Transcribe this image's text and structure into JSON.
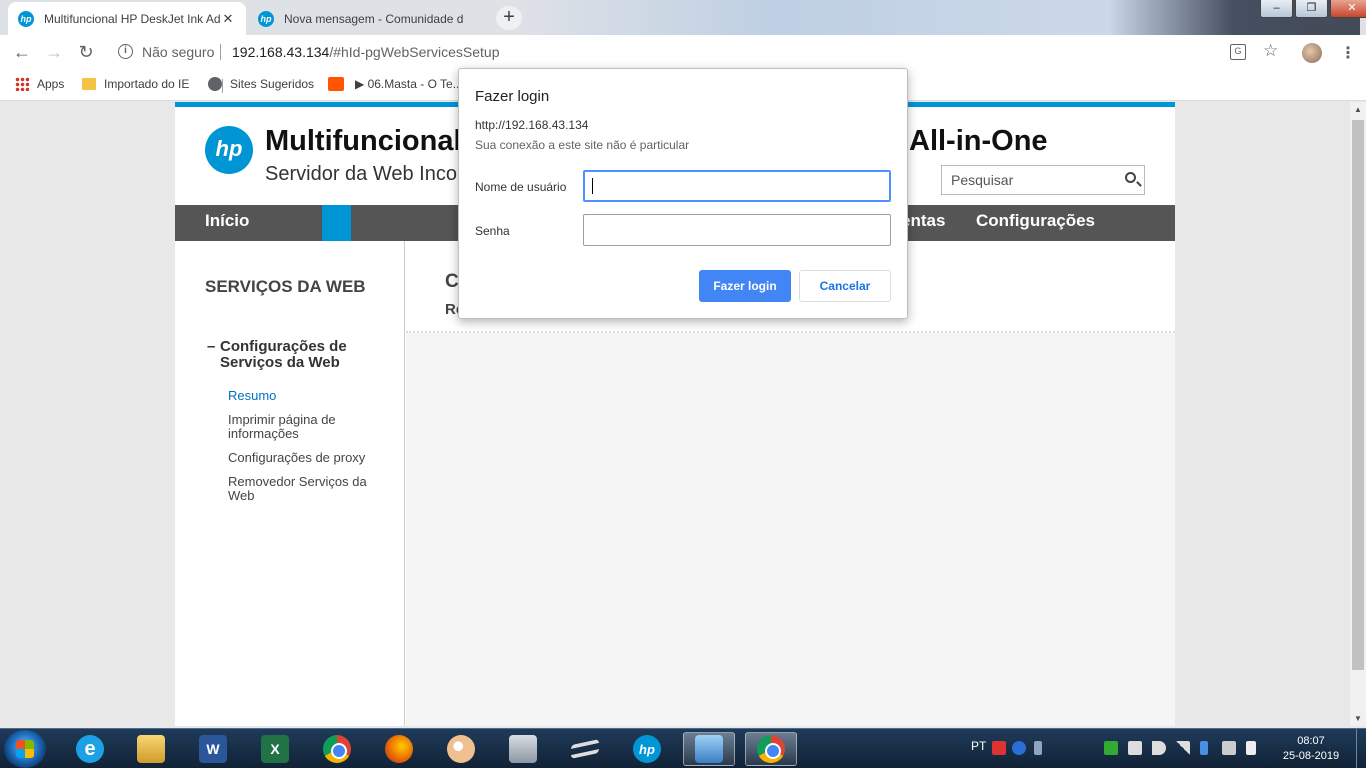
{
  "browser": {
    "tabs": [
      {
        "title": "Multifuncional HP DeskJet Ink Ad",
        "favicon": "hp",
        "active": true
      },
      {
        "title": "Nova mensagem - Comunidade d",
        "favicon": "hp",
        "active": false
      }
    ],
    "security_label": "Não seguro",
    "url_host": "192.168.43.134",
    "url_path": "/#hId-pgWebServicesSetup",
    "bookmarks": [
      {
        "label": "Apps",
        "icon": "apps-grid-icon"
      },
      {
        "label": "Importado do IE",
        "icon": "folder-icon"
      },
      {
        "label": "Sites Sugeridos",
        "icon": "globe-icon"
      },
      {
        "label": "",
        "icon": "soundcloud-icon"
      },
      {
        "label": "▶ 06.Masta - O Te...",
        "icon": ""
      }
    ]
  },
  "hp": {
    "title_start": "Multifuncional",
    "title_end": "All-in-One",
    "subtitle": "Servidor da Web Incorporado",
    "search_placeholder": "Pesquisar",
    "nav": {
      "home": "Início",
      "tools_partial": "entas",
      "settings": "Configurações"
    },
    "sidebar": {
      "title": "SERVIÇOS DA WEB",
      "group_marker": "–",
      "group": "Configurações de Serviços da Web",
      "links": [
        "Resumo",
        "Imprimir página de informações",
        "Configurações de proxy",
        "Removedor Serviços da Web"
      ]
    },
    "main": {
      "heading_partial": "Co",
      "subheading_partial": "Re"
    },
    "colors": {
      "brand": "#0096d6",
      "nav_bg": "#555555"
    }
  },
  "login_dialog": {
    "title": "Fazer login",
    "host": "http://192.168.43.134",
    "note": "Sua conexão a este site não é particular",
    "username_label": "Nome de usuário",
    "username_value": "",
    "password_label": "Senha",
    "password_value": "",
    "login_button": "Fazer login",
    "cancel_button": "Cancelar"
  },
  "taskbar": {
    "language": "PT",
    "time": "08:07",
    "date": "25-08-2019",
    "apps": [
      "internet-explorer",
      "file-explorer",
      "word",
      "excel",
      "chrome",
      "firefox",
      "paint",
      "calculator",
      "scanner",
      "hp",
      "control-panel",
      "chrome-active"
    ]
  }
}
